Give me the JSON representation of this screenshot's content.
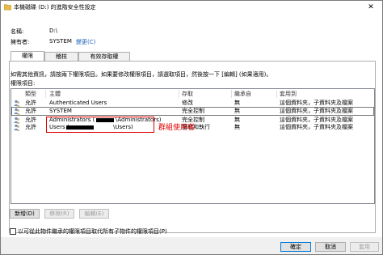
{
  "window": {
    "title": "本機磁碟 (D:) 的進階安全性設定",
    "close_glyph": "✕"
  },
  "details": {
    "name_label": "名稱:",
    "name_value": "D:\\",
    "owner_label": "擁有者:",
    "owner_value": "SYSTEM",
    "change_link": "變更(C)"
  },
  "tabs": [
    {
      "label": "權限",
      "active": true
    },
    {
      "label": "稽核",
      "active": false
    },
    {
      "label": "有效存取權",
      "active": false
    }
  ],
  "panel": {
    "info_text": "如需其他資訊，請按兩下權限項目。如果要修改權限項目，請選取項目，然後按一下 [編輯] (如果適用)。",
    "entries_label": "權限項目:"
  },
  "columns": [
    "類型",
    "主體",
    "存取",
    "繼承自",
    "套用到"
  ],
  "rows": [
    {
      "type": "允許",
      "principal": "Authenticated Users",
      "access": "修改",
      "inherited": "無",
      "applies": "這個資料夾，子資料夾及檔案"
    },
    {
      "type": "允許",
      "principal": "SYSTEM",
      "access": "完全控制",
      "inherited": "無",
      "applies": "這個資料夾，子資料夾及檔案"
    },
    {
      "type": "允許",
      "principal": "Administrators (",
      "principal_suffix": "\\Administrators)",
      "access": "完全控制",
      "inherited": "無",
      "applies": "這個資料夾，子資料夾及檔案"
    },
    {
      "type": "允許",
      "principal": "Users (",
      "principal_suffix": "\\Users)",
      "access": "讀取和執行",
      "inherited": "無",
      "applies": "這個資料夾，子資料夾及檔案"
    }
  ],
  "annotation": {
    "text": "群組使用者",
    "color": "#e00000"
  },
  "buttons": {
    "add": "新增(D)",
    "remove": "移除(R)",
    "edit": "編輯(E)",
    "ok": "確定",
    "cancel": "取消",
    "apply": "套用"
  },
  "checkbox_label": "以可從此物件繼承的權限項目取代所有子物件的權限項目(P)",
  "icons": {
    "title": "folder-icon",
    "row": "user-group-icon"
  }
}
